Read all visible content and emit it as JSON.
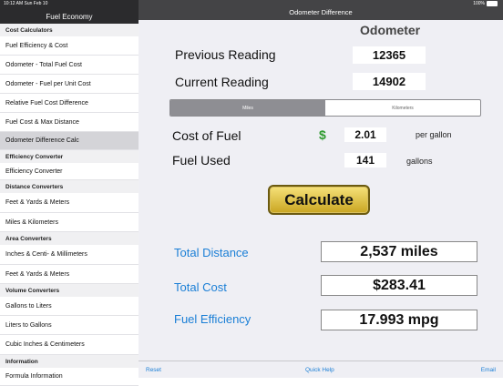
{
  "status": {
    "time": "10:12 AM  Sun Feb 10",
    "battery": "100%"
  },
  "sidebar": {
    "title": "Fuel Economy",
    "sections": [
      {
        "header": "Cost Calculators",
        "items": [
          "Fuel Efficiency & Cost",
          "Odometer - Total Fuel Cost",
          "Odometer - Fuel per Unit Cost",
          "Relative Fuel Cost Difference",
          "Fuel Cost & Max Distance",
          "Odometer Difference Calc"
        ]
      },
      {
        "header": "Efficiency Converter",
        "items": [
          "Efficiency Converter"
        ]
      },
      {
        "header": "Distance Converters",
        "items": [
          "Feet & Yards & Meters",
          "Miles & Kilometers"
        ]
      },
      {
        "header": "Area Converters",
        "items": [
          "Inches & Centi- & Millimeters",
          "Feet & Yards & Meters"
        ]
      },
      {
        "header": "Volume Converters",
        "items": [
          "Gallons to Liters",
          "Liters to Gallons",
          "Cubic Inches & Centimeters"
        ]
      },
      {
        "header": "Information",
        "items": [
          "Formula Information"
        ]
      }
    ],
    "selected": "Odometer Difference Calc"
  },
  "main": {
    "nav_title": "Odometer Difference",
    "heading": "Odometer",
    "previous_label": "Previous Reading",
    "previous_value": "12365",
    "current_label": "Current Reading",
    "current_value": "14902",
    "segment": {
      "miles": "Miles",
      "kilometers": "Kilometers",
      "selected": "Miles"
    },
    "cost_label": "Cost of Fuel",
    "currency": "$",
    "cost_value": "2.01",
    "cost_unit": "per gallon",
    "fuel_label": "Fuel Used",
    "fuel_value": "141",
    "fuel_unit": "gallons",
    "calculate": "Calculate",
    "results": {
      "distance_label": "Total Distance",
      "distance_value": "2,537 miles",
      "cost_label": "Total Cost",
      "cost_value": "$283.41",
      "efficiency_label": "Fuel Efficiency",
      "efficiency_value": "17.993 mpg"
    }
  },
  "toolbar": {
    "reset": "Reset",
    "help": "Quick Help",
    "email": "Email"
  },
  "colors": {
    "accent": "#1b7fd6",
    "currency_green": "#2e9a2e",
    "button_gold": "#e0c040"
  }
}
